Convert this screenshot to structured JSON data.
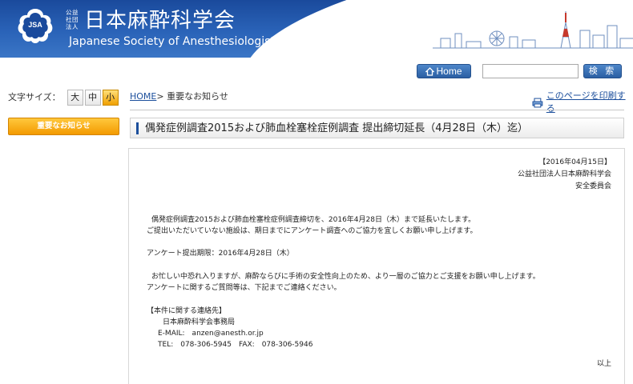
{
  "header": {
    "org_small": "公益社団法人",
    "title": "日本麻酔科学会",
    "subtitle": "Japanese Society of Anesthesiologists",
    "emblem_text": "JSA"
  },
  "toolbar": {
    "home_label": "Home",
    "search_placeholder": "",
    "search_label": "検 索"
  },
  "sidebar": {
    "font_size_label": "文字サイズ：",
    "font_sizes": [
      "大",
      "中",
      "小"
    ],
    "nav_items": [
      {
        "label": "重要なお知らせ"
      }
    ]
  },
  "breadcrumb": {
    "home": "HOME",
    "separator": ">",
    "current": "重要なお知らせ"
  },
  "print_link": "このページを印刷する",
  "article": {
    "title": "偶発症例調査2015および肺血栓塞栓症例調査 提出締切延長（4月28日（木）迄）",
    "date": "【2016年04月15日】",
    "issuer": "公益社団法人日本麻酔科学会",
    "committee": "安全委員会",
    "para1_line1": "偶発症例調査2015および肺血栓塞栓症例調査締切を、2016年4月28日（木）まで延長いたします。",
    "para1_line2": "ご提出いただいていない施設は、期日までにアンケート調査へのご協力を宜しくお願い申し上げます。",
    "deadline": "アンケート提出期限：2016年4月28日（木）",
    "para2_line1": "お忙しい中恐れ入りますが、麻酔ならびに手術の安全性向上のため、より一層のご協力とご支援をお願い申し上げます。",
    "para2_line2": "アンケートに関するご質問等は、下記までご連絡ください。",
    "contact_heading": "【本件に関する連絡先】",
    "contact_org": "日本麻酔科学会事務局",
    "contact_email": "E-MAIL:　anzen@anesth.or.jp",
    "contact_phone": "TEL:　078-306-5945　FAX:　078-306-5946",
    "end": "以上"
  },
  "colors": {
    "header_blue": "#2a63b8",
    "link_blue": "#1c4f9c",
    "accent_orange": "#f39a00"
  }
}
